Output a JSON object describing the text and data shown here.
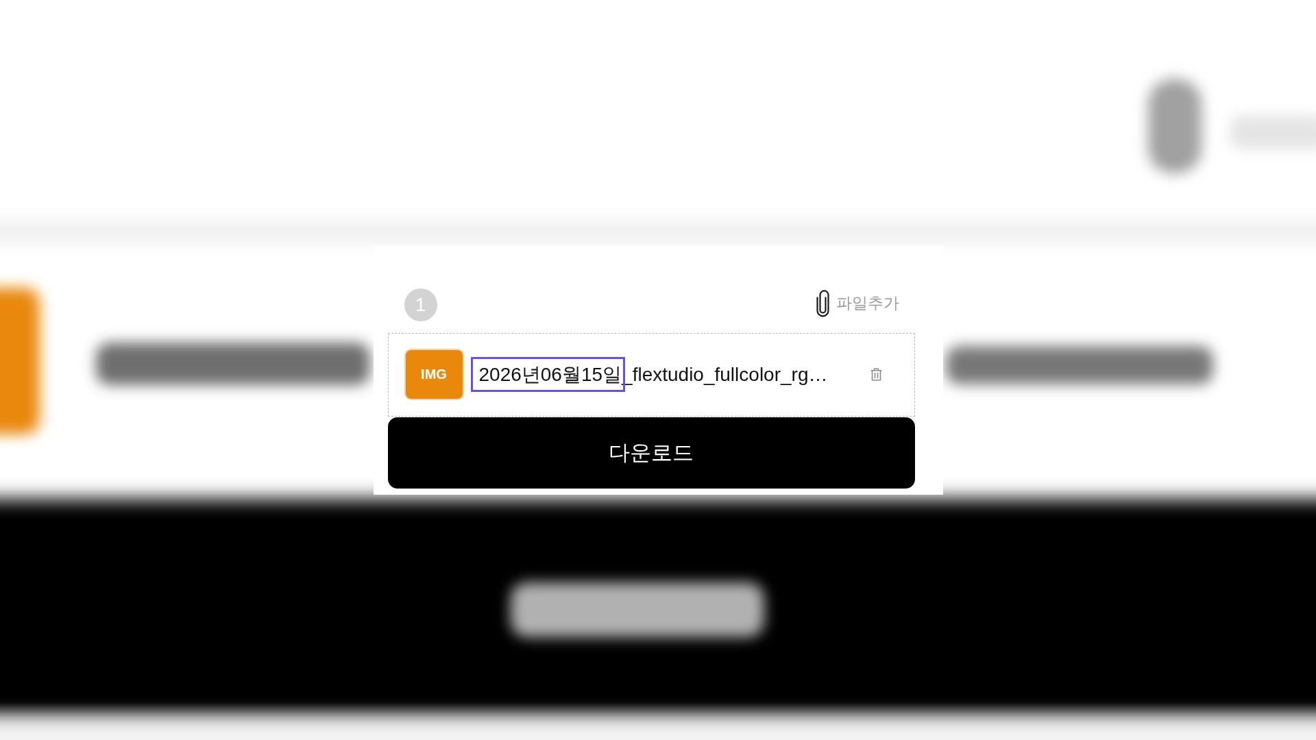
{
  "step_badge": "1",
  "add_file_button": {
    "label": "파일추가"
  },
  "file": {
    "type_badge": "IMG",
    "name_parts": [
      {
        "text": "2026년06월15일",
        "highlighted": true
      },
      {
        "text": "_flextudio_fullcolor_rg…",
        "highlighted": false
      }
    ]
  },
  "download_button": {
    "label": "다운로드"
  }
}
